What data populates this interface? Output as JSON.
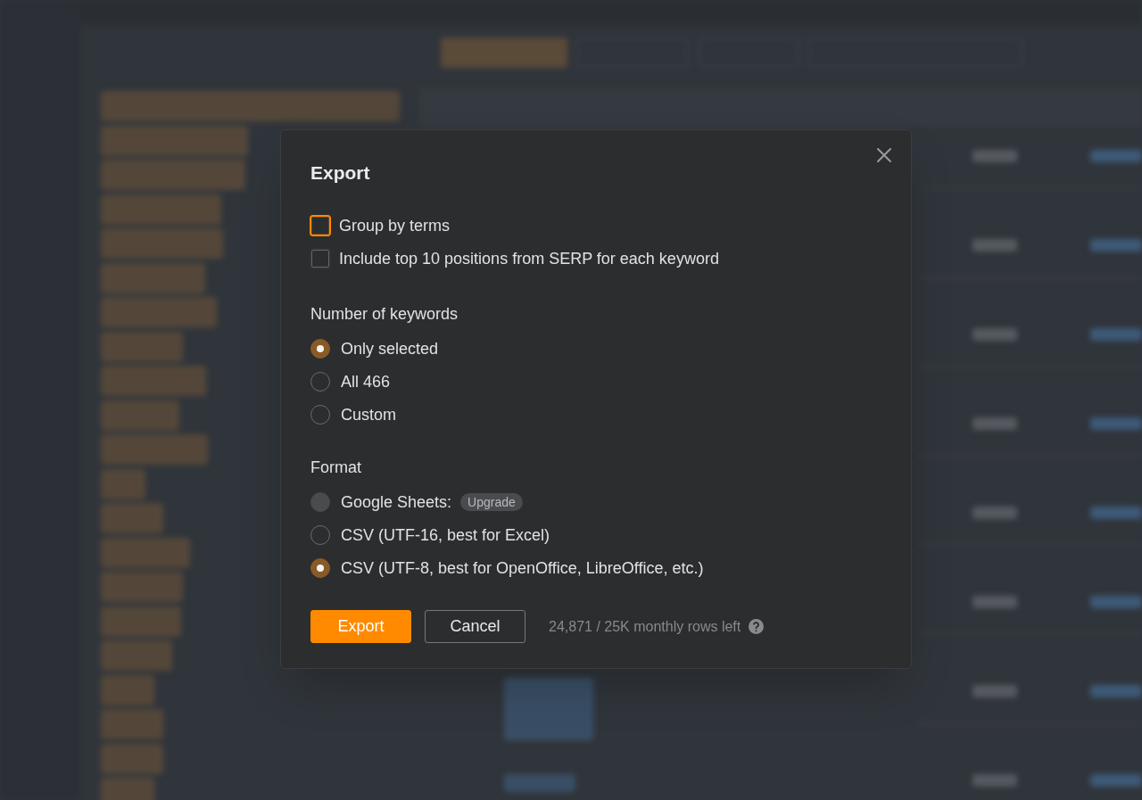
{
  "dialog": {
    "title": "Export",
    "options": [
      {
        "label": "Group by terms",
        "checked": false,
        "focused": true
      },
      {
        "label": "Include top 10 positions from SERP for each keyword",
        "checked": false,
        "focused": false
      }
    ],
    "number_of_keywords": {
      "heading": "Number of keywords",
      "choices": [
        {
          "label": "Only selected",
          "selected": true,
          "disabled": false
        },
        {
          "label": "All 466",
          "selected": false,
          "disabled": false
        },
        {
          "label": "Custom",
          "selected": false,
          "disabled": false
        }
      ]
    },
    "format": {
      "heading": "Format",
      "choices": [
        {
          "label": "Google Sheets:",
          "selected": false,
          "disabled": true,
          "badge": "Upgrade"
        },
        {
          "label": "CSV (UTF-16, best for Excel)",
          "selected": false,
          "disabled": false
        },
        {
          "label": "CSV (UTF-8, best for OpenOffice, LibreOffice, etc.)",
          "selected": true,
          "disabled": false
        }
      ]
    },
    "buttons": [
      {
        "label": "Export",
        "kind": "primary"
      },
      {
        "label": "Cancel",
        "kind": "secondary"
      }
    ],
    "quota": "24,871 / 25K monthly rows left"
  }
}
